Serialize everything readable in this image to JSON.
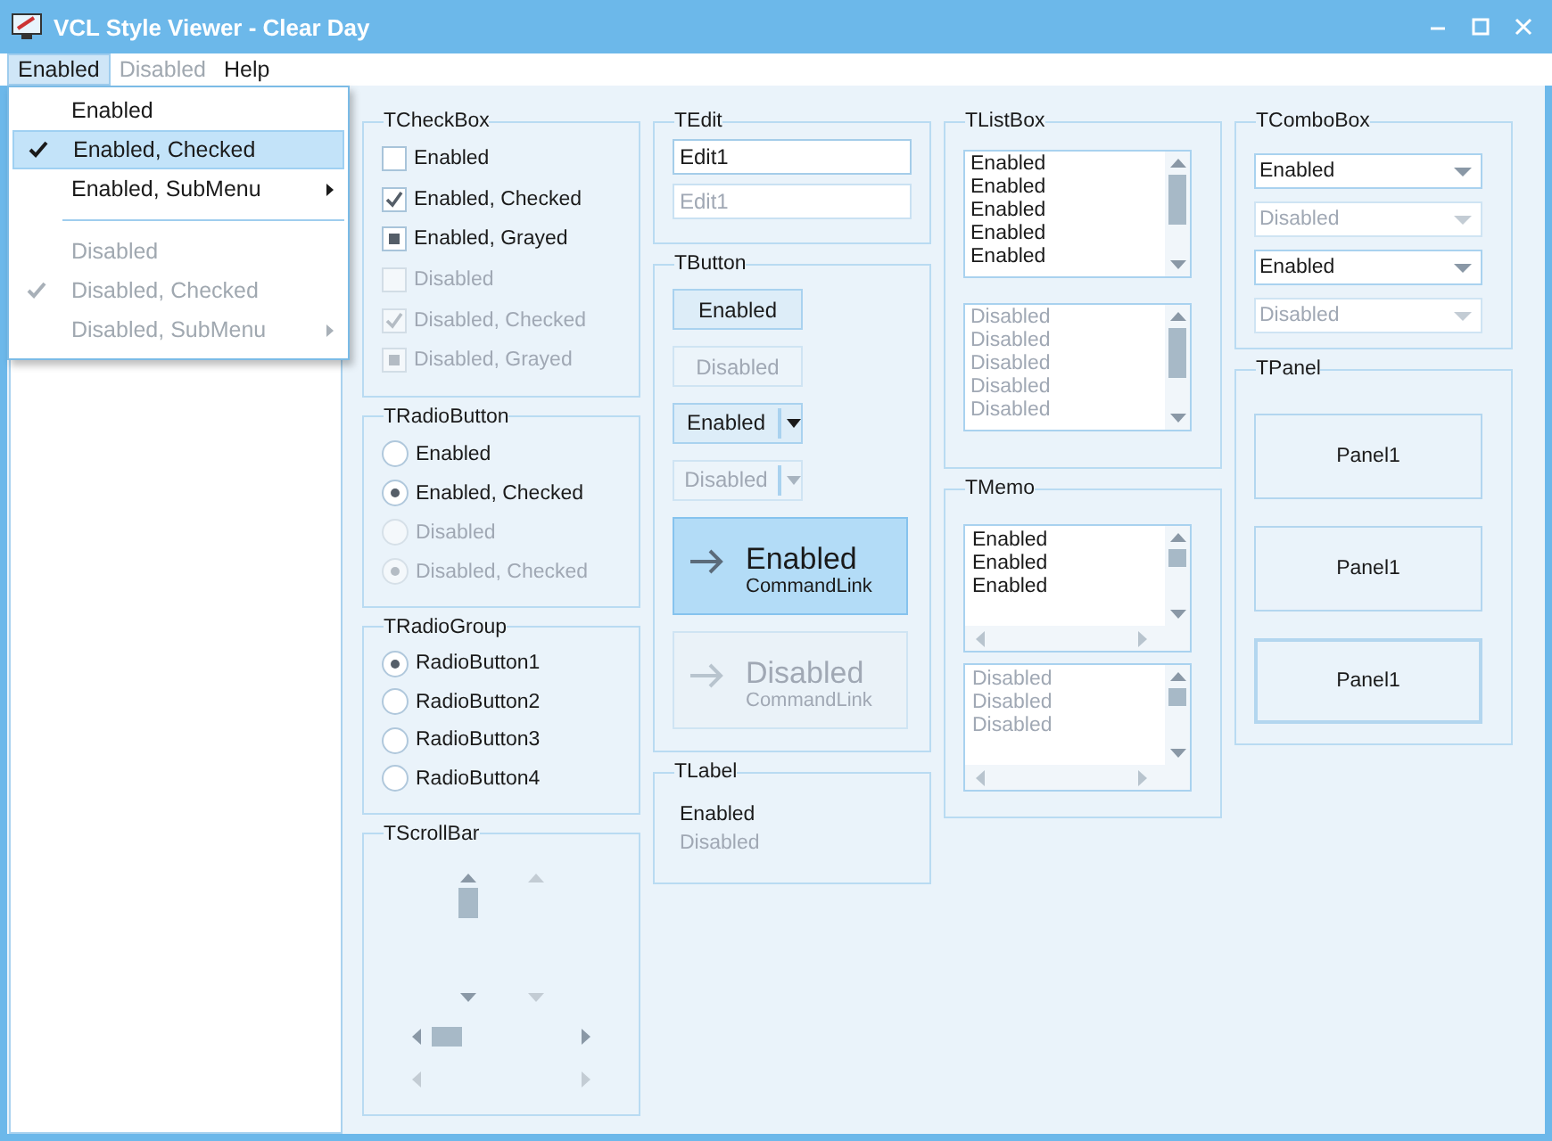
{
  "window": {
    "title": "VCL Style Viewer - Clear Day"
  },
  "menu_bar": [
    {
      "label": "Enabled",
      "selected": true,
      "disabled": false
    },
    {
      "label": "Disabled",
      "selected": false,
      "disabled": true
    },
    {
      "label": "Help",
      "selected": false,
      "disabled": false
    }
  ],
  "dropdown": {
    "items": [
      {
        "kind": "item",
        "label": "Enabled",
        "disabled": false,
        "checked": false,
        "selected": false,
        "submenu": false
      },
      {
        "kind": "item",
        "label": "Enabled, Checked",
        "disabled": false,
        "checked": true,
        "selected": true,
        "submenu": false
      },
      {
        "kind": "item",
        "label": "Enabled, SubMenu",
        "disabled": false,
        "checked": false,
        "selected": false,
        "submenu": true
      },
      {
        "kind": "separator"
      },
      {
        "kind": "item",
        "label": "Disabled",
        "disabled": true,
        "checked": false,
        "selected": false,
        "submenu": false
      },
      {
        "kind": "item",
        "label": "Disabled, Checked",
        "disabled": true,
        "checked": true,
        "selected": false,
        "submenu": false
      },
      {
        "kind": "item",
        "label": "Disabled, SubMenu",
        "disabled": true,
        "checked": false,
        "selected": false,
        "submenu": true
      }
    ]
  },
  "checkboxes": {
    "title": "TCheckBox",
    "items": [
      {
        "label": "Enabled",
        "kind": "unchecked",
        "disabled": false
      },
      {
        "label": "Enabled, Checked",
        "kind": "checked",
        "disabled": false
      },
      {
        "label": "Enabled, Grayed",
        "kind": "grayed",
        "disabled": false
      },
      {
        "label": "Disabled",
        "kind": "unchecked",
        "disabled": true
      },
      {
        "label": "Disabled, Checked",
        "kind": "checked",
        "disabled": true
      },
      {
        "label": "Disabled, Grayed",
        "kind": "grayed",
        "disabled": true
      }
    ]
  },
  "radio_buttons": {
    "title": "TRadioButton",
    "items": [
      {
        "label": "Enabled",
        "checked": false,
        "disabled": false
      },
      {
        "label": "Enabled, Checked",
        "checked": true,
        "disabled": false
      },
      {
        "label": "Disabled",
        "checked": false,
        "disabled": true
      },
      {
        "label": "Disabled, Checked",
        "checked": true,
        "disabled": true
      }
    ]
  },
  "radio_group": {
    "title": "TRadioGroup",
    "items": [
      {
        "label": "RadioButton1",
        "selected": true
      },
      {
        "label": "RadioButton2",
        "selected": false
      },
      {
        "label": "RadioButton3",
        "selected": false
      },
      {
        "label": "RadioButton4",
        "selected": false
      }
    ]
  },
  "scroll_bar": {
    "title": "TScrollBar",
    "vertical": [
      {
        "disabled": false
      },
      {
        "disabled": true
      }
    ],
    "horizontal": [
      {
        "disabled": false
      },
      {
        "disabled": true
      }
    ]
  },
  "edit": {
    "title": "TEdit",
    "fields": [
      {
        "value": "Edit1",
        "disabled": false
      },
      {
        "value": "Edit1",
        "disabled": true
      }
    ]
  },
  "buttons": {
    "title": "TButton",
    "items": [
      {
        "kind": "button",
        "label": "Enabled",
        "disabled": false
      },
      {
        "kind": "button",
        "label": "Disabled",
        "disabled": true
      },
      {
        "kind": "split",
        "label": "Enabled",
        "disabled": false
      },
      {
        "kind": "split",
        "label": "Disabled",
        "disabled": true
      },
      {
        "kind": "command_link",
        "label": "Enabled",
        "note": "CommandLink",
        "disabled": false
      },
      {
        "kind": "command_link",
        "label": "Disabled",
        "note": "CommandLink",
        "disabled": true
      }
    ]
  },
  "label": {
    "title": "TLabel",
    "items": [
      {
        "text": "Enabled",
        "disabled": false
      },
      {
        "text": "Disabled",
        "disabled": true
      }
    ]
  },
  "list_box": {
    "title": "TListBox",
    "lists": [
      {
        "disabled": false,
        "items": [
          "Enabled",
          "Enabled",
          "Enabled",
          "Enabled",
          "Enabled"
        ]
      },
      {
        "disabled": true,
        "items": [
          "Disabled",
          "Disabled",
          "Disabled",
          "Disabled",
          "Disabled"
        ]
      }
    ]
  },
  "memo": {
    "title": "TMemo",
    "memos": [
      {
        "disabled": false,
        "lines": [
          "Enabled",
          "Enabled",
          "Enabled"
        ]
      },
      {
        "disabled": true,
        "lines": [
          "Disabled",
          "Disabled",
          "Disabled"
        ]
      }
    ]
  },
  "combo_box": {
    "title": "TComboBox",
    "items": [
      {
        "value": "Enabled",
        "disabled": false
      },
      {
        "value": "Disabled",
        "disabled": true
      },
      {
        "value": "Enabled",
        "disabled": false
      },
      {
        "value": "Disabled",
        "disabled": true
      }
    ]
  },
  "panel": {
    "title": "TPanel",
    "items": [
      {
        "caption": "Panel1",
        "kind": "single"
      },
      {
        "caption": "Panel1",
        "kind": "single"
      },
      {
        "caption": "Panel1",
        "kind": "double"
      }
    ]
  }
}
